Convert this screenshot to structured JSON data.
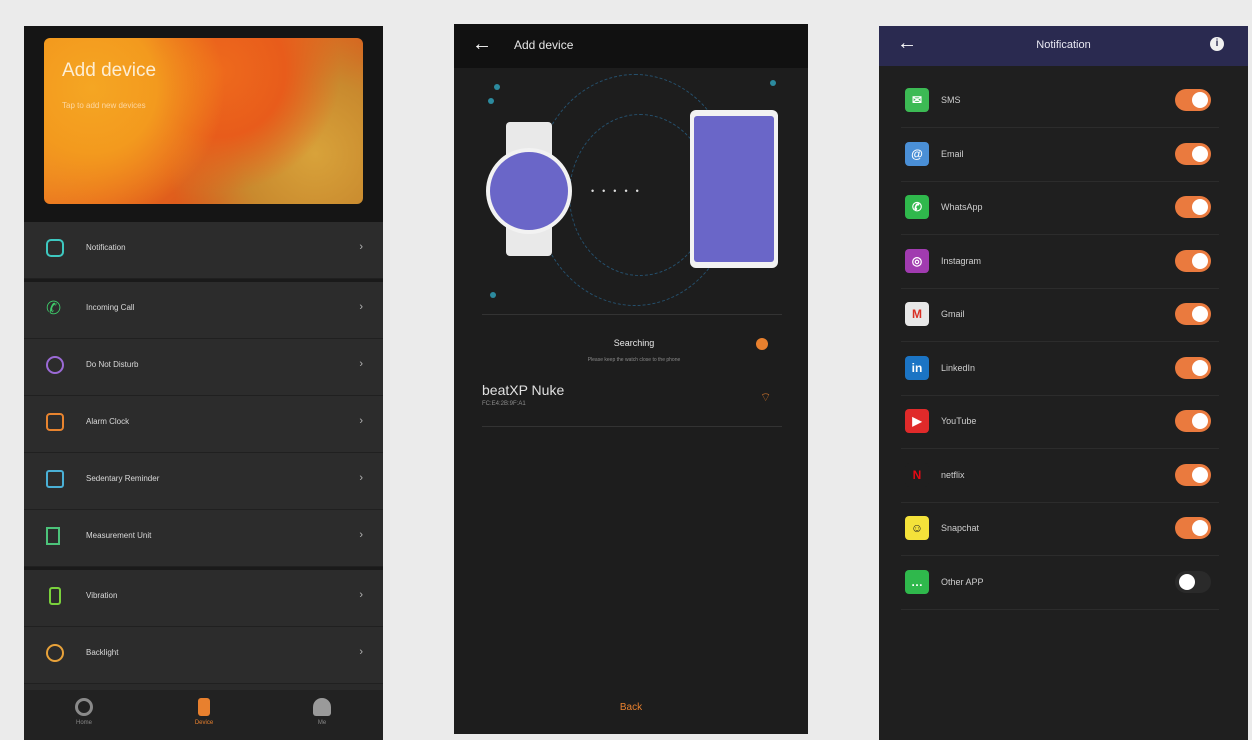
{
  "screen1": {
    "hero_title": "Add device",
    "hero_subtitle": "Tap to add new devices",
    "menu": [
      {
        "label": "Notification",
        "icon": "notification-icon",
        "color": "#3ec8c0"
      },
      {
        "label": "Incoming Call",
        "icon": "phone-icon",
        "color": "#3ecb6a"
      },
      {
        "label": "Do Not Disturb",
        "icon": "moon-icon",
        "color": "#9b6ad6"
      },
      {
        "label": "Alarm Clock",
        "icon": "alarm-icon",
        "color": "#e8842f"
      },
      {
        "label": "Sedentary Reminder",
        "icon": "home-icon",
        "color": "#4ab0d6"
      },
      {
        "label": "Measurement Unit",
        "icon": "ruler-icon",
        "color": "#4cc37a"
      },
      {
        "label": "Vibration",
        "icon": "vibration-icon",
        "color": "#7ad13c"
      },
      {
        "label": "Backlight",
        "icon": "sun-icon",
        "color": "#e8a23a"
      }
    ],
    "tabs": [
      {
        "label": "Home",
        "icon": "home-tab-icon"
      },
      {
        "label": "Device",
        "icon": "device-tab-icon"
      },
      {
        "label": "Me",
        "icon": "profile-tab-icon"
      }
    ]
  },
  "screen2": {
    "title": "Add device",
    "searching": "Searching",
    "searching_hint": "Please keep the watch close to the phone",
    "device_name": "beatXP Nuke",
    "device_mac": "FC:E4:2B:9F:A1",
    "back_label": "Back"
  },
  "screen3": {
    "title": "Notification",
    "apps": [
      {
        "label": "SMS",
        "color": "#3cba54",
        "glyph": "✉",
        "on": true
      },
      {
        "label": "Email",
        "color": "#4a8fd6",
        "glyph": "@",
        "on": true
      },
      {
        "label": "WhatsApp",
        "color": "#2fb84c",
        "glyph": "✆",
        "on": true
      },
      {
        "label": "Instagram",
        "color": "#a13bb0",
        "glyph": "◎",
        "on": true
      },
      {
        "label": "Gmail",
        "color": "#e8e8e8",
        "glyph": "M",
        "on": true
      },
      {
        "label": "LinkedIn",
        "color": "#1b74c4",
        "glyph": "in",
        "on": true
      },
      {
        "label": "YouTube",
        "color": "#e02a2a",
        "glyph": "▶",
        "on": true
      },
      {
        "label": "netflix",
        "color": "#1f1f1f",
        "glyph": "N",
        "on": true
      },
      {
        "label": "Snapchat",
        "color": "#f4e23a",
        "glyph": "☺",
        "on": true
      },
      {
        "label": "Other APP",
        "color": "#2fb84c",
        "glyph": "…",
        "on": false
      }
    ]
  }
}
